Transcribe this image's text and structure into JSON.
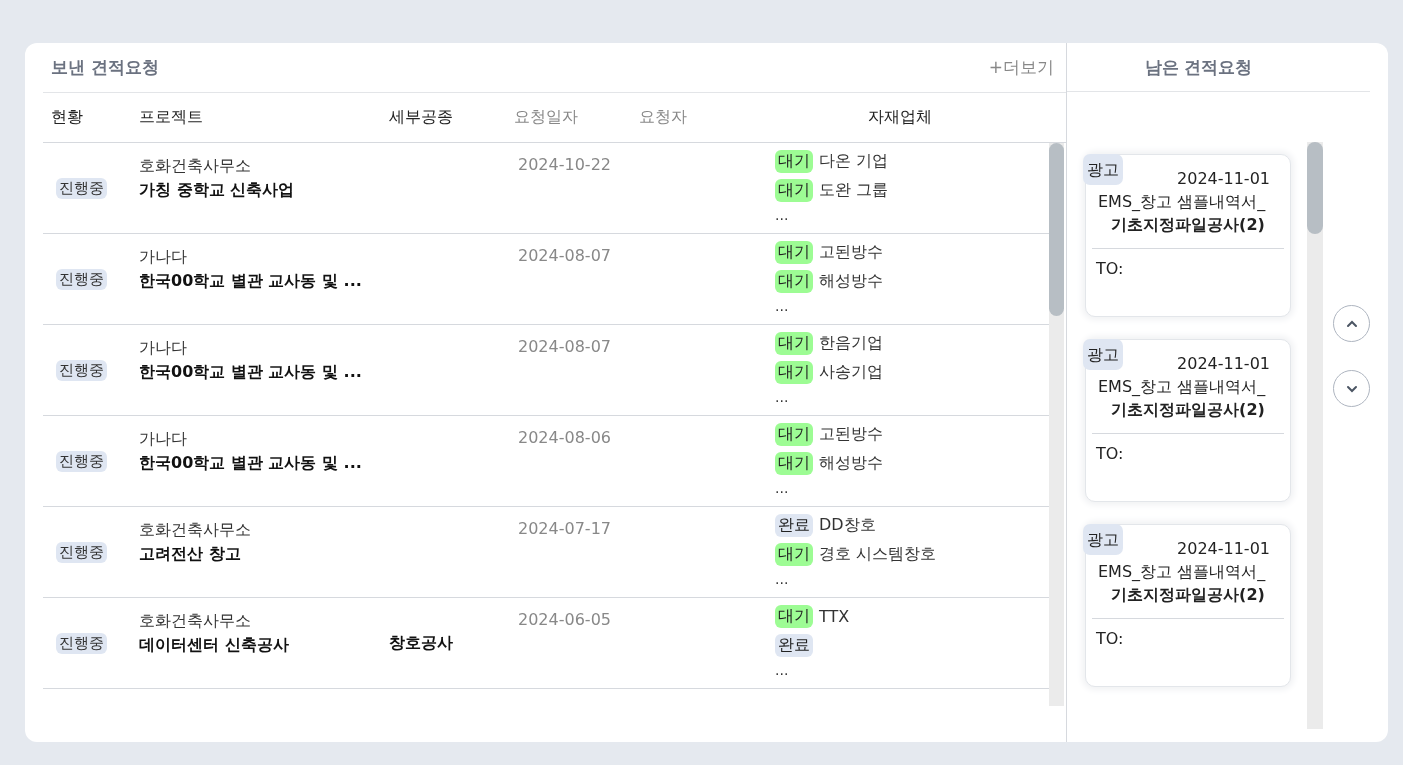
{
  "sent": {
    "title": "보낸 견적요청",
    "more": "+더보기",
    "columns": [
      {
        "label": "현황",
        "muted": false
      },
      {
        "label": "프로젝트",
        "muted": false
      },
      {
        "label": "세부공종",
        "muted": false
      },
      {
        "label": "요청일자",
        "muted": true
      },
      {
        "label": "요청자",
        "muted": true
      },
      {
        "label": "자재업체",
        "muted": false
      }
    ],
    "rows": [
      {
        "status": "진행중",
        "company": "호화건축사무소",
        "project": "가칭 중학교 신축사업",
        "date": "2024-10-22",
        "vendors": [
          {
            "status": "대기",
            "color": "#9dfc94",
            "name": "다온 기업"
          },
          {
            "status": "대기",
            "color": "#9dfc94",
            "name": "도완 그룹"
          }
        ],
        "more": "..."
      },
      {
        "status": "진행중",
        "company": "가나다",
        "project": "한국00학교 별관 교사동 및 ...",
        "date": "2024-08-07",
        "vendors": [
          {
            "status": "대기",
            "color": "#9dfc94",
            "name": "고된방수"
          },
          {
            "status": "대기",
            "color": "#9dfc94",
            "name": "해성방수"
          }
        ],
        "more": "..."
      },
      {
        "status": "진행중",
        "company": "가나다",
        "project": "한국00학교 별관 교사동 및 ...",
        "date": "2024-08-07",
        "vendors": [
          {
            "status": "대기",
            "color": "#9dfc94",
            "name": "한음기업"
          },
          {
            "status": "대기",
            "color": "#9dfc94",
            "name": "사송기업"
          }
        ],
        "more": "..."
      },
      {
        "status": "진행중",
        "company": "가나다",
        "project": "한국00학교 별관 교사동 및 ...",
        "date": "2024-08-06",
        "vendors": [
          {
            "status": "대기",
            "color": "#9dfc94",
            "name": "고된방수"
          },
          {
            "status": "대기",
            "color": "#9dfc94",
            "name": "해성방수"
          }
        ],
        "more": "..."
      },
      {
        "status": "진행중",
        "company": "호화건축사무소",
        "project": "고려전산 창고",
        "date": "2024-07-17",
        "vendors": [
          {
            "status": "완료",
            "color": "#dfe6f2",
            "name": "DD창호"
          },
          {
            "status": "대기",
            "color": "#9dfc94",
            "name": "경호 시스템창호"
          }
        ],
        "more": "..."
      },
      {
        "status": "진행중",
        "company": "호화건축사무소",
        "project": "데이터센터 신축공사",
        "work_type": "창호공사",
        "date": "2024-06-05",
        "vendors": [
          {
            "status": "대기",
            "color": "#9dfc94",
            "name": "TTX"
          },
          {
            "status": "완료",
            "color": "#dfe6f2"
          }
        ],
        "more": "..."
      }
    ]
  },
  "remaining": {
    "title": "남은 견적요청",
    "cards": [
      {
        "tag": "광고",
        "date": "2024-11-01",
        "title": "EMS_창고 샘플내역서_",
        "subtitle": "기초지정파일공사(2)",
        "to": "TO:"
      },
      {
        "tag": "광고",
        "date": "2024-11-01",
        "title": "EMS_창고 샘플내역서_",
        "subtitle": "기초지정파일공사(2)",
        "to": "TO:"
      },
      {
        "tag": "광고",
        "date": "2024-11-01",
        "title": "EMS_창고 샘플내역서_",
        "subtitle": "기초지정파일공사(2)",
        "to": "TO:"
      }
    ]
  }
}
